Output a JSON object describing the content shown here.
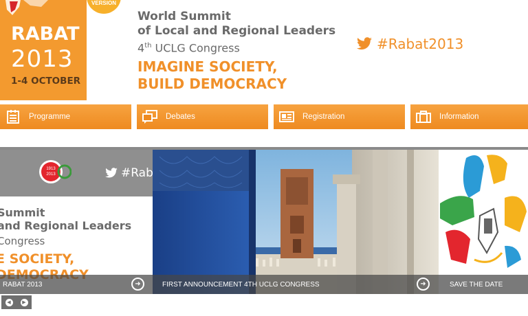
{
  "header": {
    "logo": {
      "city": "RABAT",
      "year": "2013",
      "dates": "1-4 OCTOBER",
      "badge": "VERSION"
    },
    "title_line1": "World Summit",
    "title_line2": "of Local and Regional Leaders",
    "congress_num": "4",
    "congress_sup": "th",
    "congress_rest": " UCLG Congress",
    "slogan_line1": "IMAGINE SOCIETY,",
    "slogan_line2": "BUILD DEMOCRACY",
    "twitter_tag": "#Rabat2013"
  },
  "nav": {
    "items": [
      {
        "label": "Programme",
        "icon": "calendar-list-icon"
      },
      {
        "label": "Debates",
        "icon": "speech-bubbles-icon"
      },
      {
        "label": "Registration",
        "icon": "id-card-icon"
      },
      {
        "label": "Information",
        "icon": "briefcase-icon"
      }
    ]
  },
  "slider": {
    "slide1": {
      "badge_top": "1913",
      "badge_bottom": "2013",
      "twitter_tag": "#Rab",
      "title_line1": "Summit",
      "title_line2": "and Regional Leaders",
      "sub": "Congress",
      "slogan_line1": "E SOCIETY,",
      "slogan_line2": "DEMOCRACY",
      "caption": "RABAT 2013"
    },
    "slide2": {
      "caption": "FIRST ANNOUNCEMENT 4TH UCLG CONGRESS"
    },
    "slide3": {
      "caption": "SAVE THE DATE"
    }
  },
  "controls": {
    "prev_icon": "prev-arrow-icon",
    "next_icon": "next-arrow-icon"
  },
  "colors": {
    "orange": "#f39a2f",
    "nav_orange": "#ee8a20",
    "text_gray": "#6a6a6a"
  }
}
